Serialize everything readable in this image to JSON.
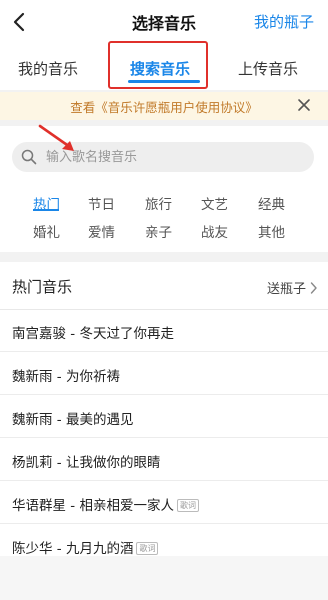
{
  "header": {
    "title": "选择音乐",
    "my_bottle": "我的瓶子",
    "back_icon": "back-arrow-icon"
  },
  "tabs": [
    {
      "label": "我的音乐",
      "active": false
    },
    {
      "label": "搜索音乐",
      "active": true
    },
    {
      "label": "上传音乐",
      "active": false
    }
  ],
  "notice": {
    "text": "查看《音乐许愿瓶用户使用协议》",
    "close_icon": "close-icon"
  },
  "search": {
    "placeholder": "输入歌名搜音乐",
    "icon": "search-icon"
  },
  "categories": [
    "热门",
    "节日",
    "旅行",
    "文艺",
    "经典",
    "婚礼",
    "爱情",
    "亲子",
    "战友",
    "其他"
  ],
  "active_category": "热门",
  "hot_music": {
    "title": "热门音乐",
    "send_label": "送瓶子",
    "songs": [
      {
        "text": "南宫嘉骏 - 冬天过了你再走",
        "badge": ""
      },
      {
        "text": "魏新雨 - 为你祈祷",
        "badge": ""
      },
      {
        "text": "魏新雨 - 最美的遇见",
        "badge": ""
      },
      {
        "text": "杨凯莉 - 让我做你的眼睛",
        "badge": ""
      },
      {
        "text": "华语群星 - 相亲相爱一家人",
        "badge": "歌词"
      },
      {
        "text": "陈少华 - 九月九的酒",
        "badge": "歌词"
      }
    ]
  },
  "colors": {
    "accent": "#1a86e8",
    "annotation_red": "#e0302b",
    "notice_bg": "#fdf6e4",
    "notice_text": "#c17a2a"
  }
}
